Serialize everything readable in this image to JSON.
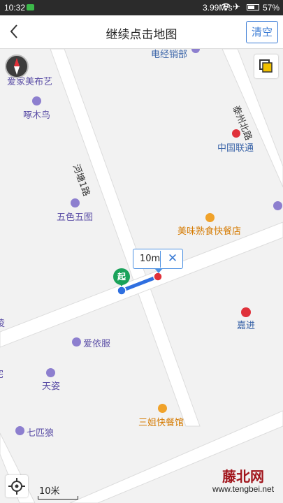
{
  "status_bar": {
    "time": "10:32",
    "network_speed": "3.99M/s",
    "battery": "57%",
    "icons": [
      "sim-icon",
      "wifi-icon",
      "airplane-icon",
      "battery-icon"
    ]
  },
  "header": {
    "title": "继续点击地图",
    "clear_label": "清空",
    "back_icon": "chevron-left-icon"
  },
  "map": {
    "roads": {
      "he_tang": "河塘1路",
      "tai_zhou": "泰州北路"
    },
    "pois": {
      "dianjing": "电经销部",
      "aijia": "爱家美布艺",
      "zhuomuniao": "啄木鸟",
      "zhongguo_liantong": "中国联通",
      "wuse": "五色五图",
      "meiwei": "美味熟食快餐店",
      "jiajin": "嘉进",
      "aiyifu": "爱依服",
      "tianzi": "天姿",
      "qipilang": "七匹狼",
      "sanjie": "三姐快餐馆",
      "edge_left_1": "凌",
      "edge_left_2": "宅"
    },
    "measure": {
      "distance": "10m",
      "start_label": "起"
    },
    "scale": "10米"
  },
  "watermark": {
    "name": "藤北网",
    "url": "www.tengbei.net"
  },
  "colors": {
    "route": "#2f6fe0",
    "start_pin": "#1aa25a",
    "end_point": "#e0313a",
    "accent": "#3a7bd5"
  }
}
